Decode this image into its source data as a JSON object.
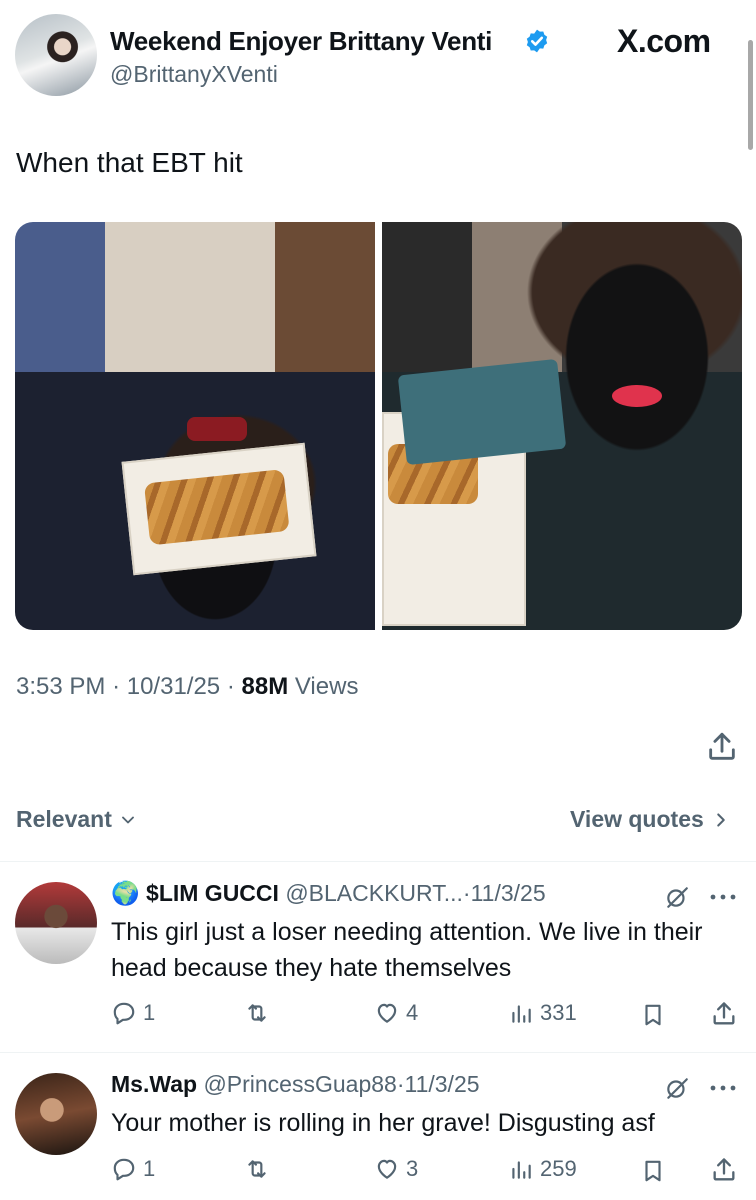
{
  "author": {
    "name": "Weekend Enjoyer Brittany Venti",
    "handle": "@BrittanyXVenti",
    "verified": true
  },
  "site_logo": "X.com",
  "post": {
    "text": "When that EBT hit",
    "time": "3:53 PM",
    "date": "10/31/25",
    "views_count": "88M",
    "views_label": "Views",
    "separator": "·"
  },
  "replies_bar": {
    "sort_label": "Relevant",
    "view_quotes": "View quotes"
  },
  "replies": [
    {
      "flag_emoji": "🌍",
      "name": "$LIM GUCCI",
      "handle": "@BLACKKURT...",
      "date": "11/3/25",
      "text": "This girl just a loser needing attention. We live in their head because they hate themselves",
      "replies": "1",
      "reposts": "",
      "likes": "4",
      "views": "331"
    },
    {
      "name": "Ms.Wap",
      "handle": "@PrincessGuap88",
      "date": "11/3/25",
      "text": "Your mother is rolling in her grave! Disgusting asf",
      "replies": "1",
      "reposts": "",
      "likes": "3",
      "views": "259"
    }
  ],
  "colors": {
    "text": "#0f1419",
    "muted": "#536471",
    "verified_blue": "#1d9bf0",
    "divider": "#eff3f4"
  }
}
